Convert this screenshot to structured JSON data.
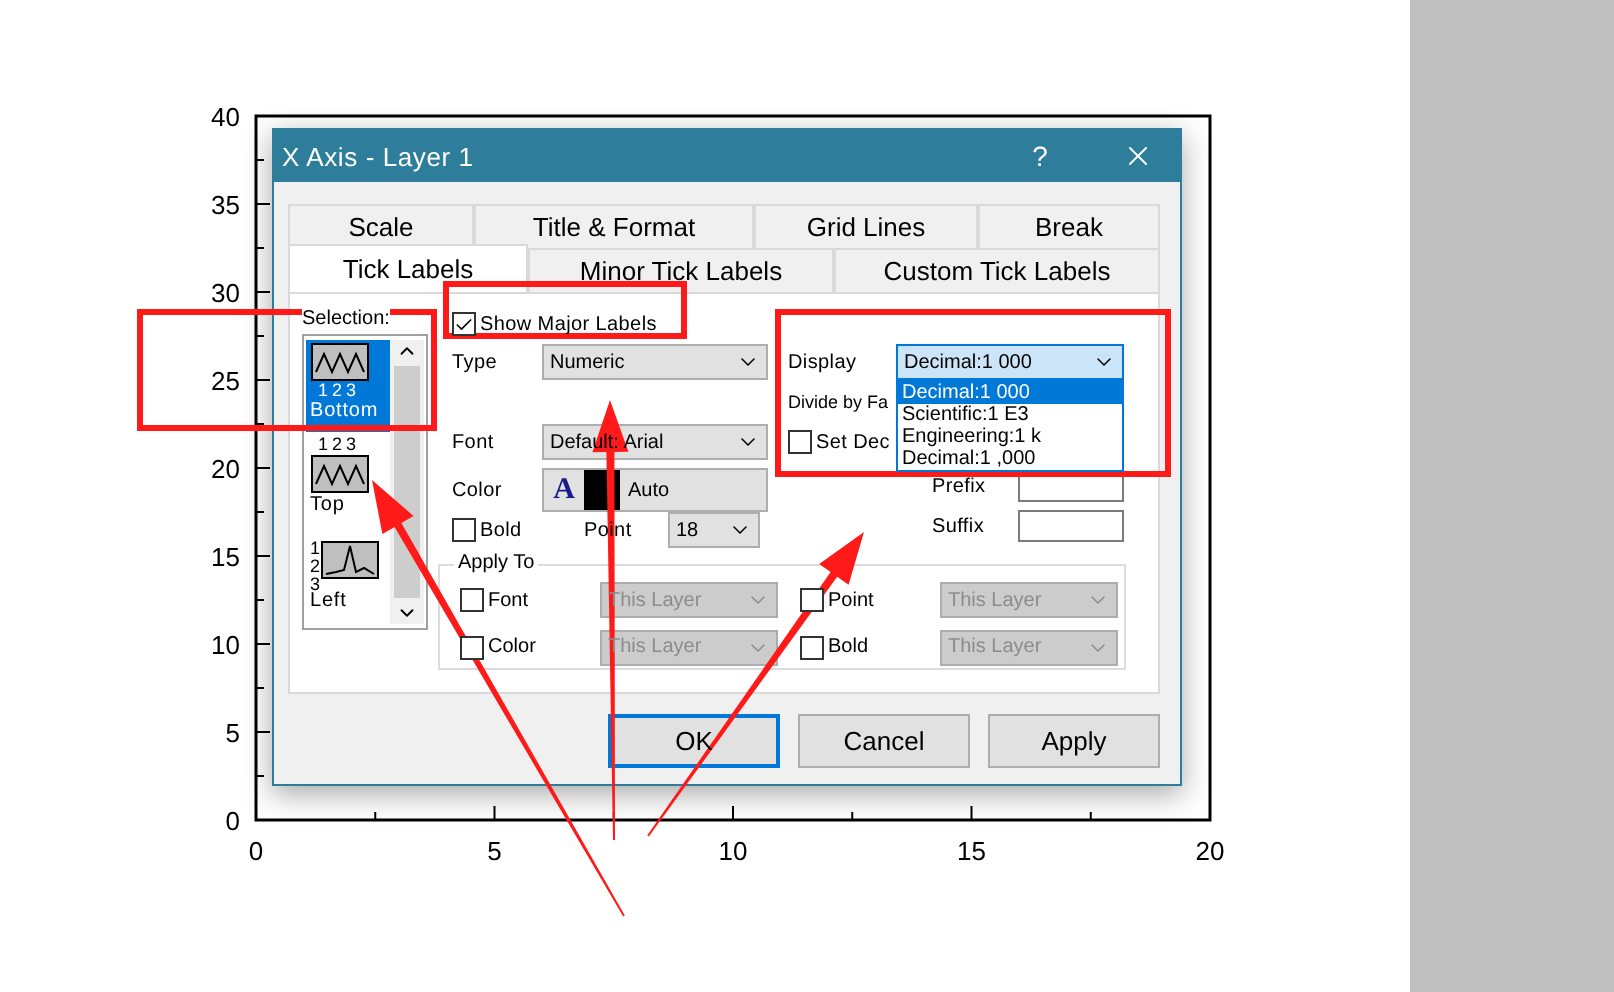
{
  "chart": {
    "chart_data": {
      "type": "line",
      "xlim": [
        0,
        20
      ],
      "ylim": [
        0,
        40
      ],
      "xticks": [
        0,
        5,
        10,
        15,
        20
      ],
      "yticks": [
        0,
        5,
        10,
        15,
        20,
        25,
        30,
        35,
        40
      ]
    }
  },
  "dialog": {
    "title": "X Axis - Layer 1",
    "help": "?"
  },
  "tab_rows": [
    {
      "tabs": [
        {
          "label": "Scale",
          "selected": false
        },
        {
          "label": "Title & Format",
          "selected": false
        },
        {
          "label": "Grid Lines",
          "selected": false
        },
        {
          "label": "Break",
          "selected": false
        }
      ]
    },
    {
      "tabs": [
        {
          "label": "Tick Labels",
          "selected": true
        },
        {
          "label": "Minor Tick Labels",
          "selected": false
        },
        {
          "label": "Custom Tick Labels",
          "selected": false
        }
      ]
    }
  ],
  "selection": {
    "label": "Selection:",
    "items": [
      {
        "label": "Bottom",
        "kind": "bottom",
        "selected": true,
        "ticks": [
          "1",
          "2",
          "3"
        ]
      },
      {
        "label": "Top",
        "kind": "top",
        "selected": false,
        "ticks": [
          "1",
          "2",
          "3"
        ]
      },
      {
        "label": "Left",
        "kind": "left",
        "selected": false,
        "ticks": [
          "1",
          "2",
          "3"
        ]
      }
    ]
  },
  "show_major_labels": {
    "label": "Show Major Labels",
    "checked": true
  },
  "type": {
    "label": "Type",
    "value": "Numeric"
  },
  "font": {
    "label": "Font",
    "value": "Default: Arial"
  },
  "color": {
    "label": "Color",
    "glyph": "A",
    "value": "Auto"
  },
  "bold": {
    "label": "Bold",
    "checked": false
  },
  "point": {
    "label": "Point",
    "value": "18"
  },
  "apply_to": {
    "label": "Apply To",
    "items": [
      {
        "label": "Font",
        "checked": false,
        "value": "This Layer",
        "disabled": true
      },
      {
        "label": "Point",
        "checked": false,
        "value": "This Layer",
        "disabled": true
      },
      {
        "label": "Color",
        "checked": false,
        "value": "This Layer",
        "disabled": true
      },
      {
        "label": "Bold",
        "checked": false,
        "value": "This Layer",
        "disabled": true
      }
    ]
  },
  "display": {
    "label": "Display",
    "value": "Decimal:1 000",
    "expanded": true,
    "options": [
      {
        "label": "Decimal:1 000",
        "selected": true
      },
      {
        "label": "Scientific:1 E3",
        "selected": false
      },
      {
        "label": "Engineering:1 k",
        "selected": false
      },
      {
        "label": "Decimal:1 ,000",
        "selected": false
      }
    ]
  },
  "divide_by_factor": {
    "label": "Divide by Fa"
  },
  "set_decimal": {
    "label": "Set Dec",
    "checked": false
  },
  "prefix": {
    "label": "Prefix"
  },
  "suffix": {
    "label": "Suffix"
  },
  "buttons": [
    {
      "label": "OK",
      "default": true
    },
    {
      "label": "Cancel",
      "default": false
    },
    {
      "label": "Apply",
      "default": false
    }
  ]
}
